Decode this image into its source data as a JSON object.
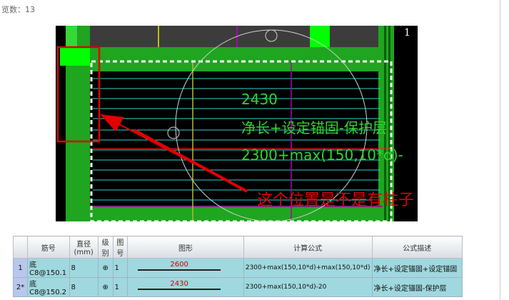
{
  "page": {
    "view_count": "览数：13"
  },
  "drawing": {
    "marker": "1",
    "annotation_lines": [
      "2430",
      "净长+设定锚固-保护层",
      "2300+max(150,10*d)-"
    ],
    "callout": "这个位置是不是有柱子",
    "colors": {
      "background": "#000000",
      "beam": "#1fa51f",
      "highlight": "#00ff00",
      "text": "#2fd52f",
      "callout": "#e00000"
    }
  },
  "table": {
    "headers": [
      "筋号",
      "直径(mm)",
      "级别",
      "图号",
      "图形",
      "计算公式",
      "公式描述"
    ],
    "rows": [
      {
        "index": "1",
        "name": "底C8@150.1",
        "diameter": "8",
        "grade": "⊕",
        "shape_no": "1",
        "length": "2600",
        "formula": "2300+max(150,10*d)+max(150,10*d)",
        "desc": "净长+设定锚固+设定锚固"
      },
      {
        "index": "2*",
        "name": "底C8@150.2",
        "diameter": "8",
        "grade": "⊕",
        "shape_no": "1",
        "length": "2430",
        "formula": "2300+max(150,10*d)-20",
        "desc": "净长+设定锚固-保护层"
      }
    ]
  }
}
